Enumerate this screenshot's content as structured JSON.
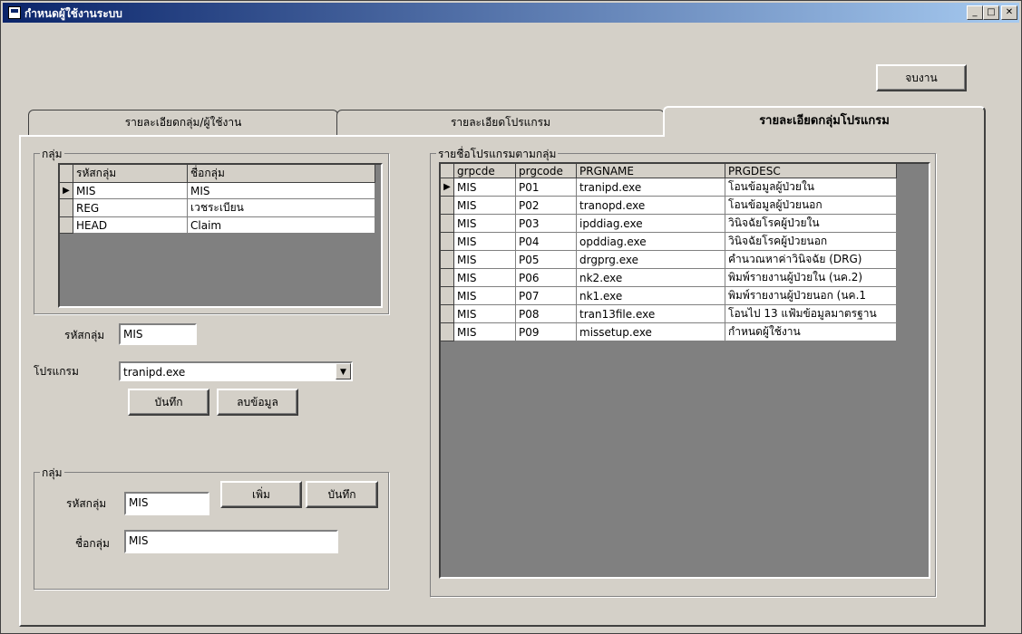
{
  "window": {
    "title": "กำหนดผู้ใช้งานระบบ"
  },
  "title_buttons": {
    "minimize": "_",
    "maximize": "□",
    "close": "✕"
  },
  "end_button": "จบงาน",
  "tabs": [
    "รายละเอียดกลุ่ม/ผู้ใช้งาน",
    "รายละเอียดโปรแกรม",
    "รายละเอียดกลุ่มโปรแกรม"
  ],
  "active_tab": 2,
  "group_frame": {
    "label": "กลุ่ม",
    "columns": [
      "รหัสกลุ่ม",
      "ชื่อกลุ่ม"
    ],
    "rows": [
      [
        "MIS",
        "MIS"
      ],
      [
        "REG",
        "เวชระเบียน"
      ],
      [
        "HEAD",
        "Claim"
      ]
    ],
    "selected_row": 0
  },
  "group_code_label": "รหัสกลุ่ม",
  "group_code_value": "MIS",
  "program_label": "โปรแกรม",
  "program_value": "tranipd.exe",
  "save_button": "บันทึก",
  "delete_button": "ลบข้อมูล",
  "program_list": {
    "label": "รายชื่อโปรแกรมตามกลุ่ม",
    "columns": [
      "grpcde",
      "prgcode",
      "PRGNAME",
      "PRGDESC"
    ],
    "rows": [
      [
        "MIS",
        "P01",
        "tranipd.exe",
        "โอนข้อมูลผู้ป่วยใน"
      ],
      [
        "MIS",
        "P02",
        "tranopd.exe",
        "โอนข้อมูลผู้ป่วยนอก"
      ],
      [
        "MIS",
        "P03",
        "ipddiag.exe",
        "วินิจฉัยโรคผู้ป่วยใน"
      ],
      [
        "MIS",
        "P04",
        "opddiag.exe",
        "วินิจฉัยโรคผู้ป่วยนอก"
      ],
      [
        "MIS",
        "P05",
        "drgprg.exe",
        "คำนวณหาค่าวินิจฉัย (DRG)"
      ],
      [
        "MIS",
        "P06",
        "nk2.exe",
        "พิมพ์รายงานผู้ป่วยใน (นค.2)"
      ],
      [
        "MIS",
        "P07",
        "nk1.exe",
        "พิมพ์รายงานผู้ป่วยนอก (นค.1"
      ],
      [
        "MIS",
        "P08",
        "tran13file.exe",
        "โอนไป 13 แฟ้มข้อมูลมาตรฐาน"
      ],
      [
        "MIS",
        "P09",
        "missetup.exe",
        "กำหนดผู้ใช้งาน"
      ]
    ],
    "selected_row": 0
  },
  "group_edit": {
    "label": "กลุ่ม",
    "code_label": "รหัสกลุ่ม",
    "code_value": "MIS",
    "name_label": "ชื่อกลุ่ม",
    "name_value": "MIS",
    "add_button": "เพิ่ม",
    "save_button": "บันทึก"
  }
}
